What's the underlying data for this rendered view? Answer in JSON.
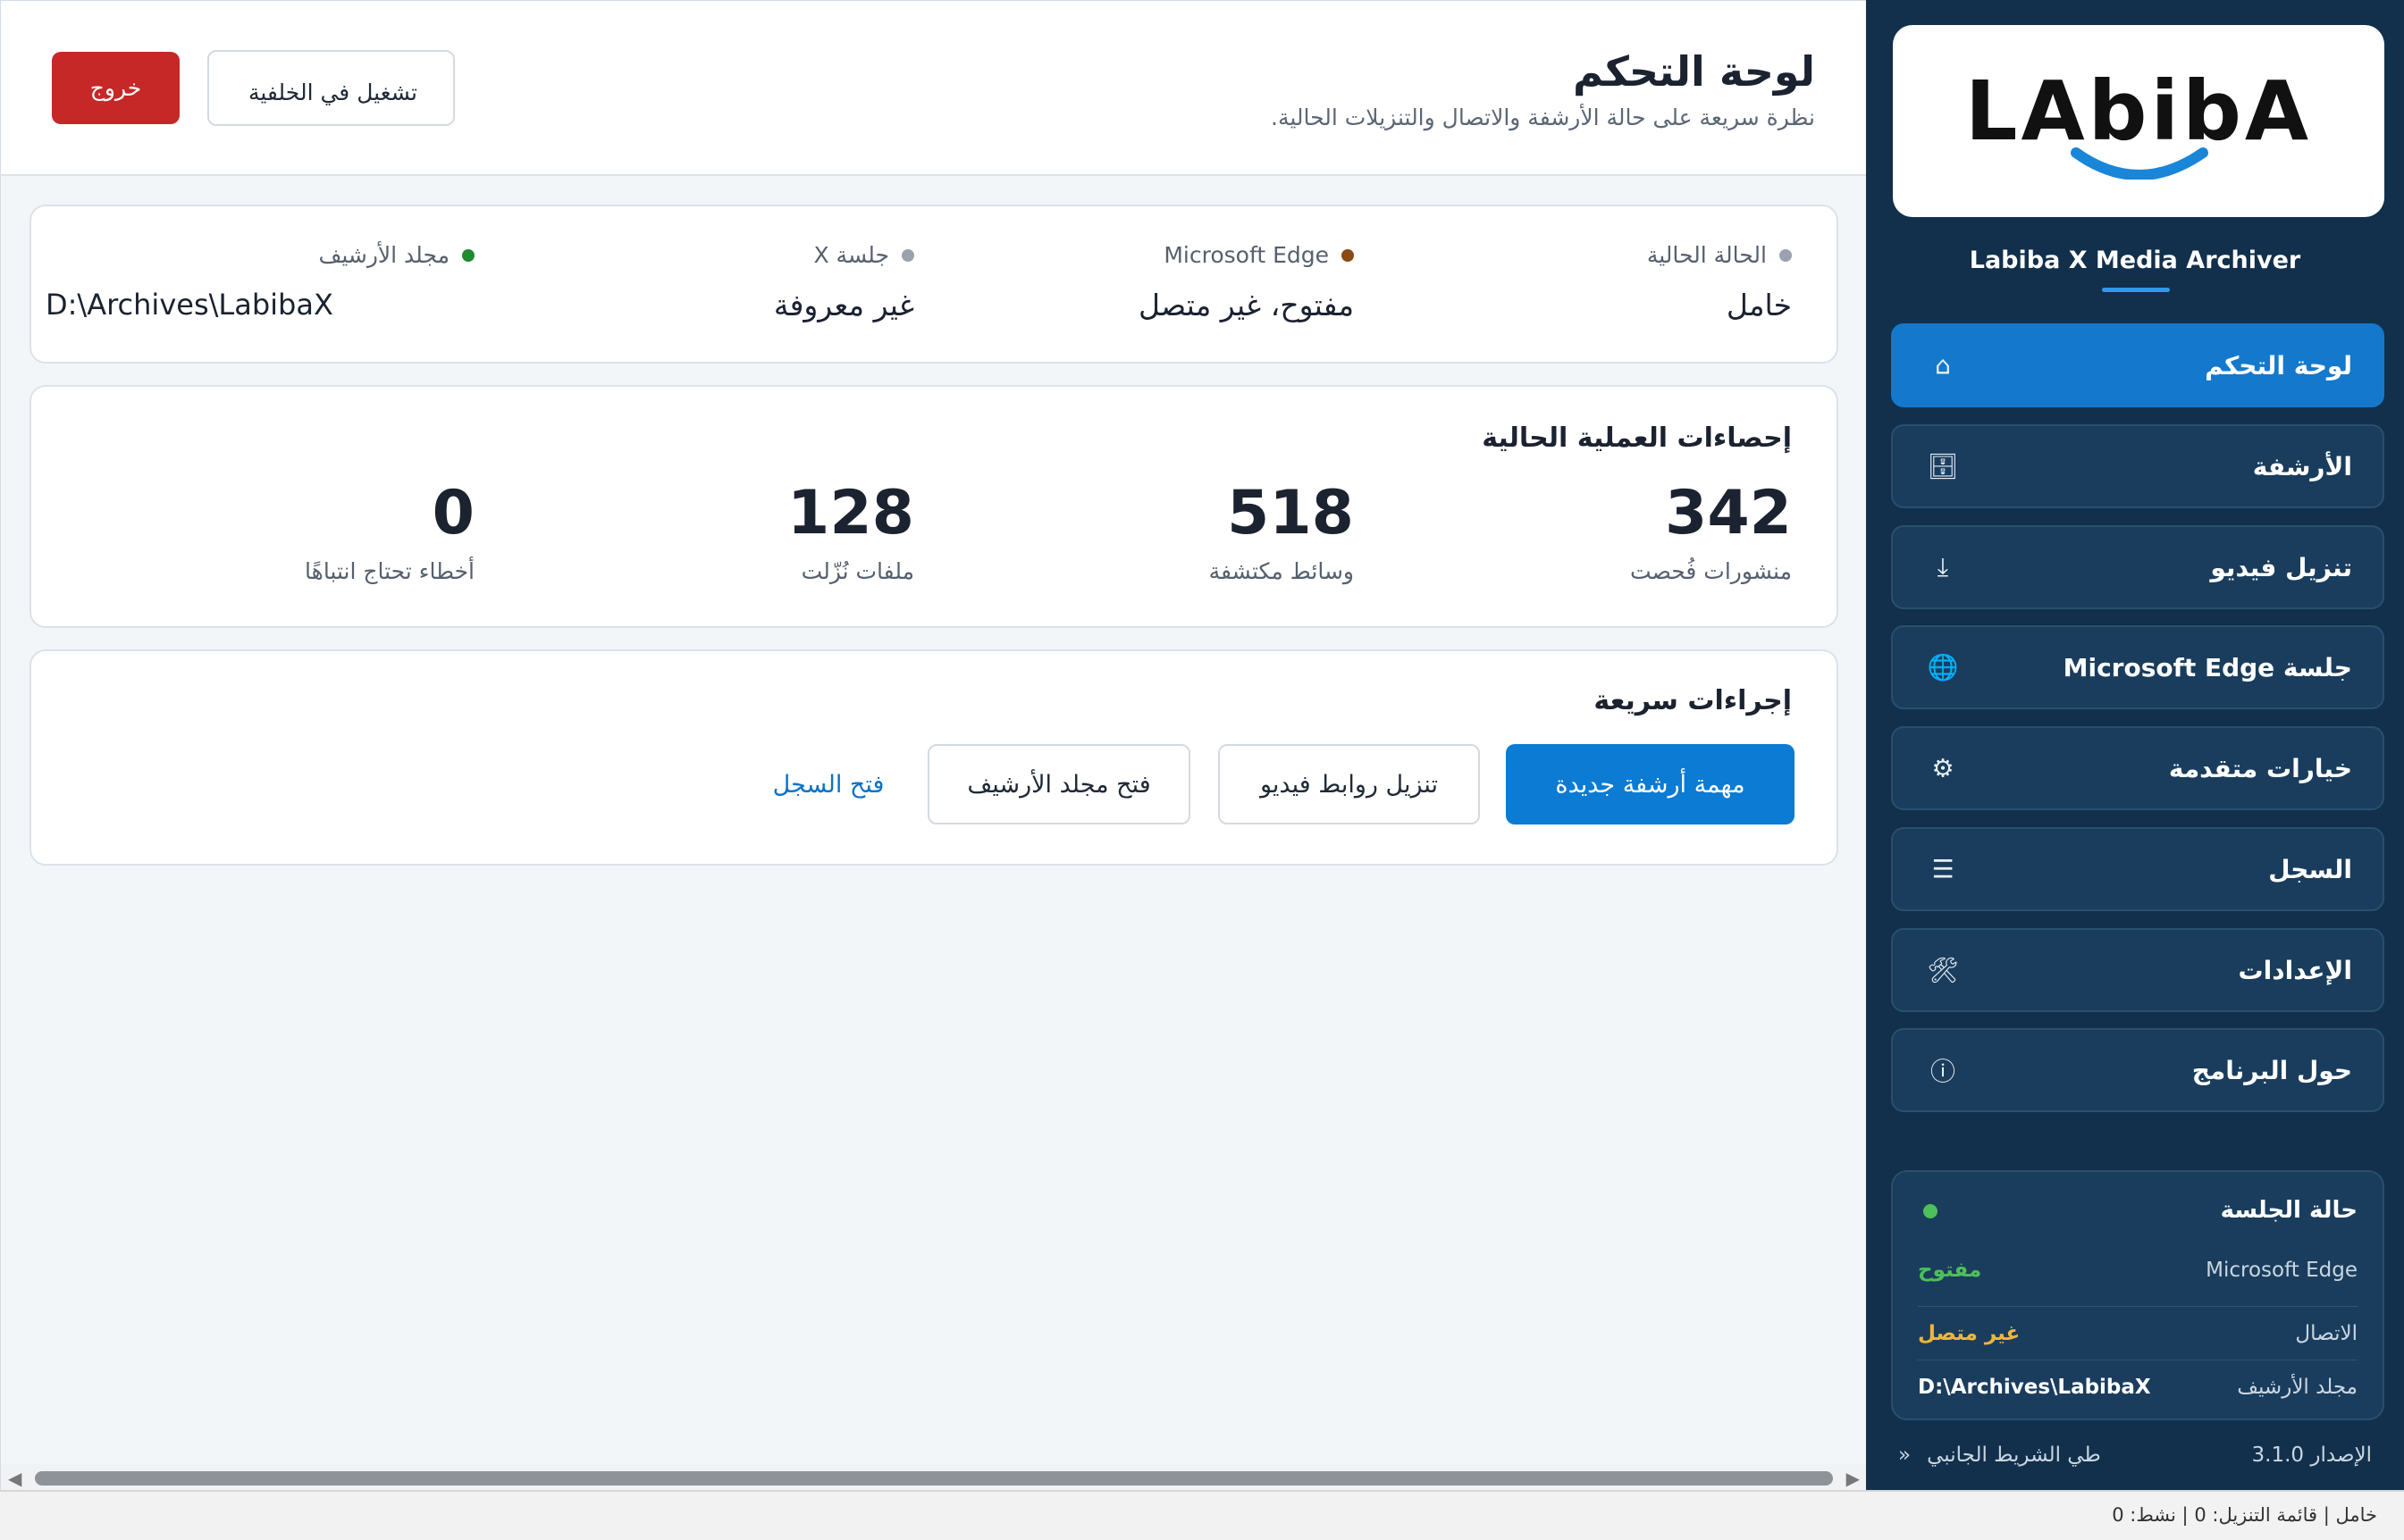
{
  "header": {
    "title": "لوحة التحكم",
    "subtitle": "نظرة سريعة على حالة الأرشفة والاتصال والتنزيلات الحالية.",
    "exit_label": "خروج",
    "background_label": "تشغيل في الخلفية"
  },
  "status": [
    {
      "label": "الحالة الحالية",
      "value": "خامل",
      "dot_color": "#9aa3ad"
    },
    {
      "label": "Microsoft Edge",
      "value": "مفتوح، غير متصل",
      "dot_color": "#8a4a12"
    },
    {
      "label": "جلسة X",
      "value": "غير معروفة",
      "dot_color": "#9aa3ad"
    },
    {
      "label": "مجلد الأرشيف",
      "value": "D:\\Archives\\LabibaX",
      "dot_color": "#1f8a2e"
    }
  ],
  "stats": {
    "title": "إحصاءات العملية الحالية",
    "items": [
      {
        "value": "342",
        "label": "منشورات فُحصت"
      },
      {
        "value": "518",
        "label": "وسائط مكتشفة"
      },
      {
        "value": "128",
        "label": "ملفات نُزّلت"
      },
      {
        "value": "0",
        "label": "أخطاء تحتاج انتباهًا"
      }
    ]
  },
  "actions": {
    "title": "إجراءات سريعة",
    "new_task": "مهمة أرشفة جديدة",
    "download_links": "تنزيل روابط فيديو",
    "open_folder": "فتح مجلد الأرشيف",
    "open_log": "فتح السجل"
  },
  "sidebar": {
    "app_name": "Labiba X Media Archiver",
    "logo_text": "LAbibA",
    "items": [
      {
        "label": "لوحة التحكم",
        "icon": "home-icon",
        "glyph": "⌂"
      },
      {
        "label": "الأرشفة",
        "icon": "archive-icon",
        "glyph": "🗄"
      },
      {
        "label": "تنزيل فيديو",
        "icon": "download-icon",
        "glyph": "⤓"
      },
      {
        "label": "جلسة Microsoft Edge",
        "icon": "globe-icon",
        "glyph": "🌐"
      },
      {
        "label": "خيارات متقدمة",
        "icon": "gear-icon",
        "glyph": "⚙"
      },
      {
        "label": "السجل",
        "icon": "list-icon",
        "glyph": "☰"
      },
      {
        "label": "الإعدادات",
        "icon": "tools-icon",
        "glyph": "🛠"
      },
      {
        "label": "حول البرنامج",
        "icon": "info-icon",
        "glyph": "ⓘ"
      }
    ],
    "session": {
      "title": "حالة الجلسة",
      "rows": [
        {
          "label": "Microsoft Edge",
          "value": "مفتوح",
          "color": "#4cc05a"
        },
        {
          "label": "الاتصال",
          "value": "غير متصل",
          "color": "#f0b43c"
        },
        {
          "label": "مجلد الأرشيف",
          "value": "D:\\Archives\\LabibaX",
          "color": "#ffffff"
        }
      ]
    },
    "version": "الإصدار 3.1.0",
    "collapse_label": "طي الشريط الجانبي",
    "collapse_glyph": "«"
  },
  "statusbar": {
    "text": "خامل  |  قائمة التنزيل: 0  |  نشط: 0"
  }
}
